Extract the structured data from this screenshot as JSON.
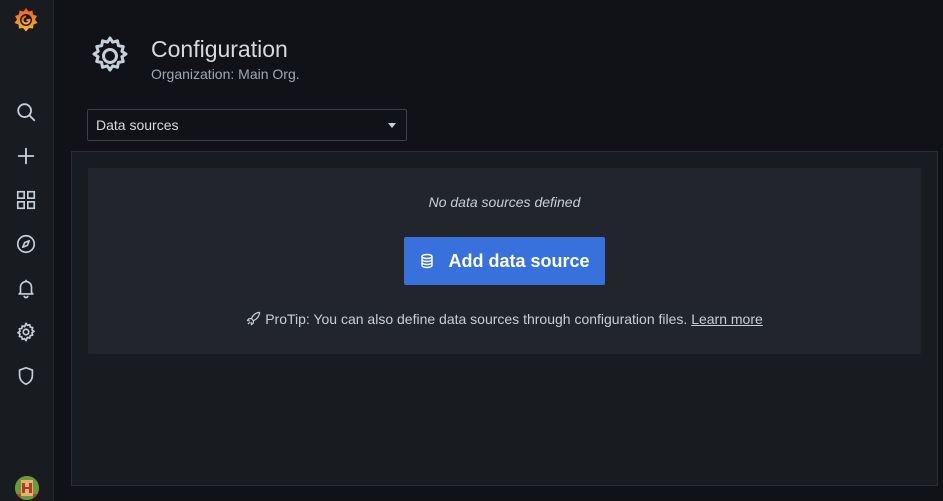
{
  "header": {
    "title": "Configuration",
    "subtitle": "Organization: Main Org."
  },
  "nav": {
    "icons": [
      "grafana-logo",
      "search-icon",
      "plus-icon",
      "dashboards-icon",
      "explore-compass-icon",
      "alert-bell-icon",
      "configuration-gear-icon",
      "shield-icon"
    ]
  },
  "select": {
    "value": "Data sources"
  },
  "empty_state": {
    "title": "No data sources defined",
    "button_label": "Add data source",
    "protip_text": "ProTip: You can also define data sources through configuration files.",
    "learn_more": "Learn more"
  },
  "colors": {
    "background": "#111217",
    "sidebar": "#181b1f",
    "card": "#22252b",
    "primary": "#3871dc"
  }
}
